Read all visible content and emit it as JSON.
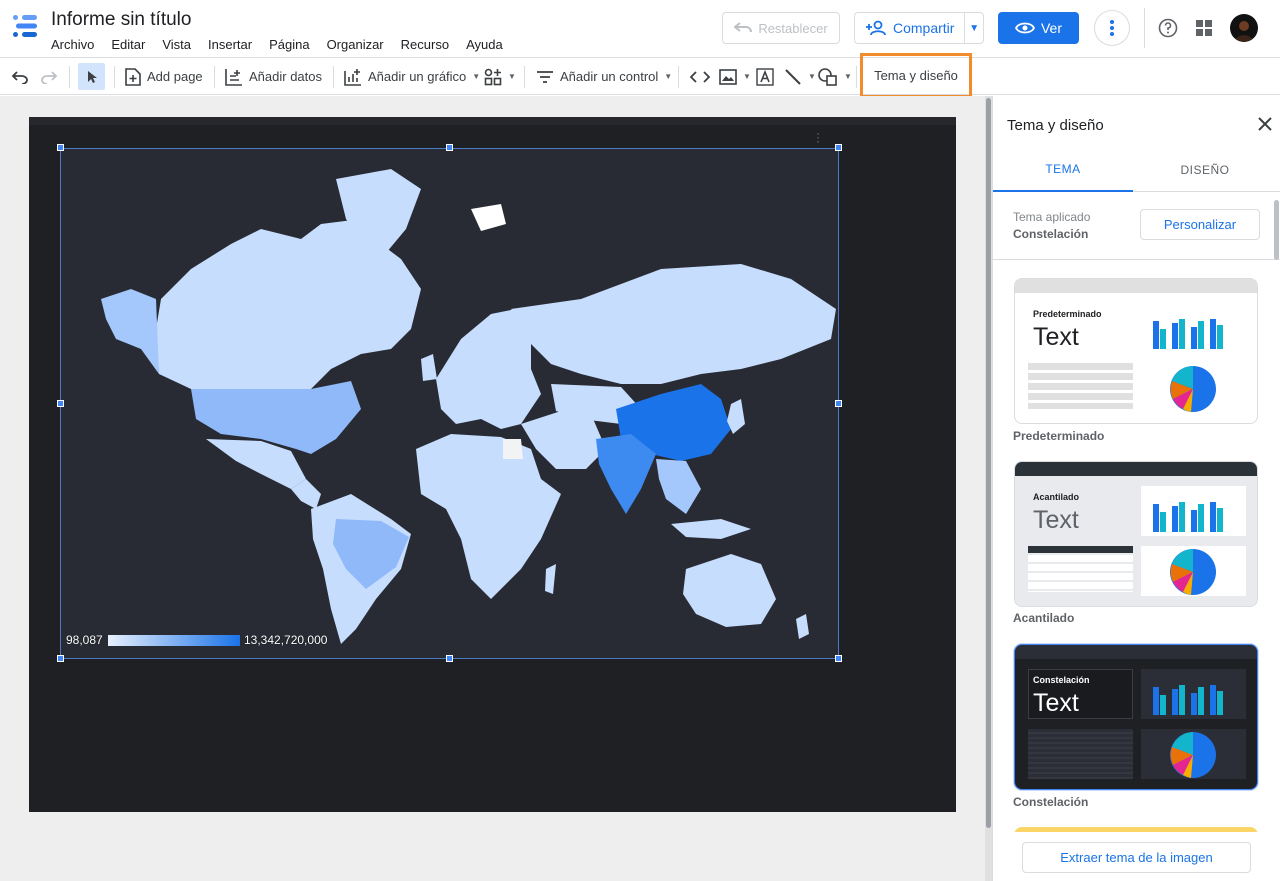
{
  "header": {
    "title": "Informe sin título",
    "menu": [
      "Archivo",
      "Editar",
      "Vista",
      "Insertar",
      "Página",
      "Organizar",
      "Recurso",
      "Ayuda"
    ],
    "reset_label": "Restablecer",
    "share_label": "Compartir",
    "view_label": "Ver"
  },
  "toolbar": {
    "add_page": "Add page",
    "add_data": "Añadir datos",
    "add_chart": "Añadir un gráfico",
    "add_control": "Añadir un control",
    "theme_layout": "Tema y diseño"
  },
  "map": {
    "legend_min": "98,087",
    "legend_max": "13,342,720,000",
    "colors": {
      "low": "#e8f0fe",
      "high": "#1a73e8",
      "background": "#282b34",
      "page": "#1e2024"
    }
  },
  "panel": {
    "title": "Tema y diseño",
    "tabs": [
      {
        "label": "TEMA",
        "active": true
      },
      {
        "label": "DISEÑO",
        "active": false
      }
    ],
    "applied_label": "Tema aplicado",
    "applied_value": "Constelación",
    "customize_label": "Personalizar",
    "themes": [
      {
        "name": "Predeterminado",
        "sample_text": "Text"
      },
      {
        "name": "Acantilado",
        "sample_text": "Text"
      },
      {
        "name": "Constelación",
        "sample_text": "Text",
        "selected": true
      }
    ],
    "extract_label": "Extraer tema de la imagen"
  }
}
